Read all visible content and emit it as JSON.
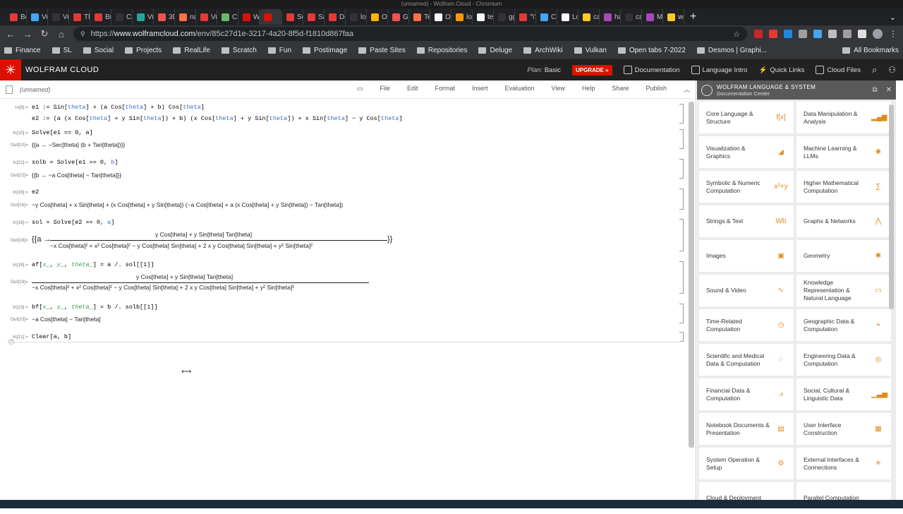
{
  "window_title": "(unnamed) - Wolfram Cloud - Chromium",
  "tabs": [
    {
      "label": "Bo",
      "color": "#e53935"
    },
    {
      "label": "Vu",
      "color": "#42a5f5"
    },
    {
      "label": "Vu",
      "color": "#333333"
    },
    {
      "label": "Th",
      "color": "#e53935"
    },
    {
      "label": "Bu",
      "color": "#e53935"
    },
    {
      "label": "Ca",
      "color": "#333333"
    },
    {
      "label": "Vu",
      "color": "#26a69a"
    },
    {
      "label": "3D",
      "color": "#ef5350"
    },
    {
      "label": "na",
      "color": "#ff7043"
    },
    {
      "label": "Vu",
      "color": "#e53935"
    },
    {
      "label": "Ch",
      "color": "#66bb6a"
    },
    {
      "label": "W",
      "color": "#dd1100"
    },
    {
      "label": "",
      "color": "#dd1100",
      "active": true
    },
    {
      "label": "Se",
      "color": "#e53935"
    },
    {
      "label": "Sa",
      "color": "#e53935"
    },
    {
      "label": "De",
      "color": "#e53935"
    },
    {
      "label": "lo",
      "color": "#333333"
    },
    {
      "label": "Ol",
      "color": "#ffb300"
    },
    {
      "label": "Ge",
      "color": "#ef5350"
    },
    {
      "label": "Te",
      "color": "#ff7043"
    },
    {
      "label": "Op",
      "color": "#ffffff"
    },
    {
      "label": "lo",
      "color": "#ff9800"
    },
    {
      "label": "te",
      "color": "#ffffff"
    },
    {
      "label": "gg",
      "color": "#333333"
    },
    {
      "label": "\"\\\"",
      "color": "#e53935"
    },
    {
      "label": "Ca",
      "color": "#42a5f5"
    },
    {
      "label": "Lo",
      "color": "#ffffff"
    },
    {
      "label": "ca",
      "color": "#ffca28"
    },
    {
      "label": "ha",
      "color": "#ab47bc"
    },
    {
      "label": "ca",
      "color": "#333333"
    },
    {
      "label": "M",
      "color": "#ab47bc"
    },
    {
      "label": "wo",
      "color": "#ffca28"
    }
  ],
  "address": {
    "scheme": "https://",
    "host": "www.wolframcloud.com",
    "path": "/env/85c27d1e-3217-4a20-8f5d-f1810d867faa"
  },
  "bookmarks": [
    "Finance",
    "SL",
    "Social",
    "Projects",
    "RealLife",
    "Scratch",
    "Fun",
    "Postimage",
    "Paste Sites",
    "Repositories",
    "Deluge",
    "ArchWiki",
    "Vulkan",
    "Open tabs 7-2022",
    "Desmos | Graphi..."
  ],
  "all_bookmarks": "All Bookmarks",
  "wolfram_bar": {
    "title": "WOLFRAM CLOUD",
    "plan_label": "Plan:",
    "plan_value": "Basic",
    "upgrade": "UPGRADE »",
    "documentation": "Documentation",
    "language_intro": "Language Intro",
    "quick_links": "Quick Links",
    "cloud_files": "Cloud Files"
  },
  "notebook": {
    "name": "(unnamed)",
    "menus": [
      "File",
      "Edit",
      "Format",
      "Insert",
      "Evaluation",
      "View",
      "Help",
      "Share",
      "Publish"
    ],
    "labels": {
      "in8": "In[8]:=",
      "in10": "In[10]:=",
      "out10": "Out[10]=",
      "in22": "In[22]:=",
      "out22": "Out[22]=",
      "in16": "In[16]:=",
      "out16": "Out[16]=",
      "in18": "In[18]:=",
      "out18": "Out[18]=",
      "in19": "In[19]:=",
      "out19": "Out[19]=",
      "in23": "In[23]:=",
      "out23": "Out[23]=",
      "in21": "In[21]:="
    },
    "out10": "{{a → −Sec[theta] (b + Tan[theta])}}",
    "out22": "{{b → −a Cos[theta] − Tan[theta]}}",
    "out16": "−y Cos[theta] + x Sin[theta] + (x Cos[theta] + y Sin[theta]) (−a Cos[theta] + a (x Cos[theta] + y Sin[theta]) − Tan[theta])",
    "out18_open": "{{a →",
    "out18_close": "}}",
    "frac_num": "y Cos[theta] + y Sin[theta] Tan[theta]",
    "frac_den": "−x Cos[theta]² + x² Cos[theta]² − y Cos[theta] Sin[theta] + 2 x y Cos[theta] Sin[theta] + y² Sin[theta]²",
    "out23": "−a Cos[theta] − Tan[theta]"
  },
  "panel": {
    "title": "WOLFRAM LANGUAGE & SYSTEM",
    "subtitle": "Documentation Center",
    "cards": [
      {
        "label": "Core Language & Structure",
        "icon": "f[x]"
      },
      {
        "label": "Data Manipulation & Analysis",
        "icon": "▂▄▆"
      },
      {
        "label": "Visualization & Graphics",
        "icon": "◢"
      },
      {
        "label": "Machine Learning & LLMs",
        "icon": "✺"
      },
      {
        "label": "Symbolic & Numeric Computation",
        "icon": "x²+y"
      },
      {
        "label": "Higher Mathematical Computation",
        "icon": "∑"
      },
      {
        "label": "Strings & Text",
        "icon": "Wb"
      },
      {
        "label": "Graphs & Networks",
        "icon": "⋀"
      },
      {
        "label": "Images",
        "icon": "▣"
      },
      {
        "label": "Geometry",
        "icon": "✱"
      },
      {
        "label": "Sound & Video",
        "icon": "∿"
      },
      {
        "label": "Knowledge Representation & Natural Language",
        "icon": "▭"
      },
      {
        "label": "Time-Related Computation",
        "icon": "◷"
      },
      {
        "label": "Geographic Data & Computation",
        "icon": "⌖"
      },
      {
        "label": "Scientific and Medical Data & Computation",
        "icon": "⁘"
      },
      {
        "label": "Engineering Data & Computation",
        "icon": "◎"
      },
      {
        "label": "Financial Data & Computation",
        "icon": "⩘"
      },
      {
        "label": "Social, Cultural & Linguistic Data",
        "icon": "▁▃▅"
      },
      {
        "label": "Notebook Documents & Presentation",
        "icon": "▤"
      },
      {
        "label": "User Interface Construction",
        "icon": "▦"
      },
      {
        "label": "System Operation & Setup",
        "icon": "⚙"
      },
      {
        "label": "External Interfaces & Connections",
        "icon": "✳"
      },
      {
        "label": "Cloud & Deployment",
        "icon": ""
      },
      {
        "label": "Parallel Computation",
        "icon": ""
      }
    ]
  }
}
